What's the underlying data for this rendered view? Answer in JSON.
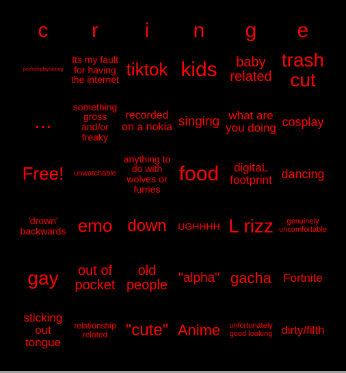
{
  "header": [
    "c",
    "r",
    "i",
    "n",
    "g",
    "e"
  ],
  "rows": [
    [
      "pov/roleplay/acting",
      "Its my fault for having the internet",
      "tiktok",
      "kids",
      "baby related",
      "trash cut"
    ],
    [
      "...",
      "something gross and/or freaky",
      "recorded on a nokia",
      "singing",
      "what are you doing",
      "cosplay"
    ],
    [
      "Free!",
      "unwatchable",
      "anything to do with wolves or furries",
      "food",
      "digitaL footprint",
      "dancing"
    ],
    [
      "'drown' backwards",
      "emo",
      "down",
      "UGHHHH",
      "L rizz",
      "genuinely uncomfortable"
    ],
    [
      "gay",
      "out of pocket",
      "old people",
      "\"alpha\"",
      "gacha",
      "Fortnite"
    ],
    [
      "sticking out tongue",
      "relationship related",
      "\"cute\"",
      "Anime",
      "unfortunately good looking",
      "dirty/filth"
    ]
  ],
  "colors": {
    "text": "#ff0000",
    "background": "#000000"
  }
}
